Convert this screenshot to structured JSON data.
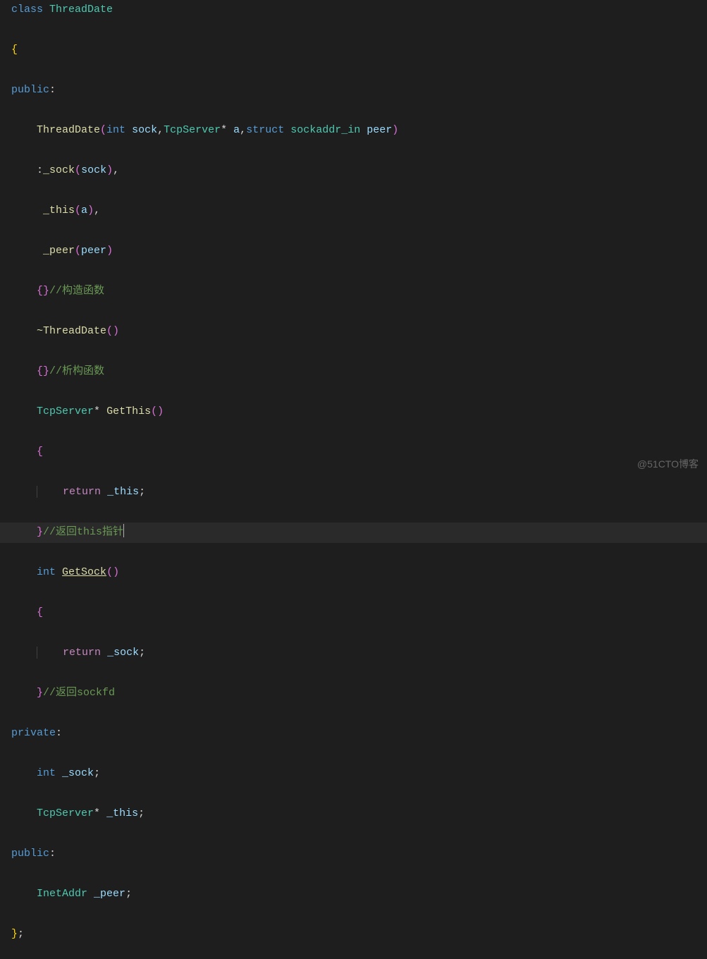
{
  "code": {
    "l1_class": "class",
    "l1_name": "ThreadDate",
    "l2_brace": "{",
    "l3_public": "public",
    "l3_colon": ":",
    "l4_ctor": "ThreadDate",
    "l4_int": "int",
    "l4_sock": "sock",
    "l4_tcp": "TcpServer",
    "l4_star": "*",
    "l4_a": "a",
    "l4_struct": "struct",
    "l4_sockaddr": "sockaddr_in",
    "l4_peer": "peer",
    "l5_sock_init": "_sock",
    "l5_sock_arg": "sock",
    "l6_this_init": "_this",
    "l6_a": "a",
    "l7_peer_init": "_peer",
    "l7_peer": "peer",
    "l8_comment": "//构造函数",
    "l9_dtor": "~ThreadDate",
    "l10_comment": "//析构函数",
    "l11_tcp": "TcpServer",
    "l11_getthis": "GetThis",
    "l13_return": "return",
    "l13_this": "_this",
    "l14_comment": "//返回this指针",
    "l15_int": "int",
    "l15_getsock": "GetSock",
    "l17_return": "return",
    "l17_sock": "_sock",
    "l18_comment": "//返回sockfd",
    "l19_private": "private",
    "l20_int": "int",
    "l20_sock": "_sock",
    "l21_tcp": "TcpServer",
    "l21_this": "_this",
    "l22_public": "public",
    "l23_inetaddr": "InetAddr",
    "l23_peer": "_peer",
    "l24_brace": "}",
    "l24_semi": ";"
  },
  "watermark": "@51CTO博客"
}
